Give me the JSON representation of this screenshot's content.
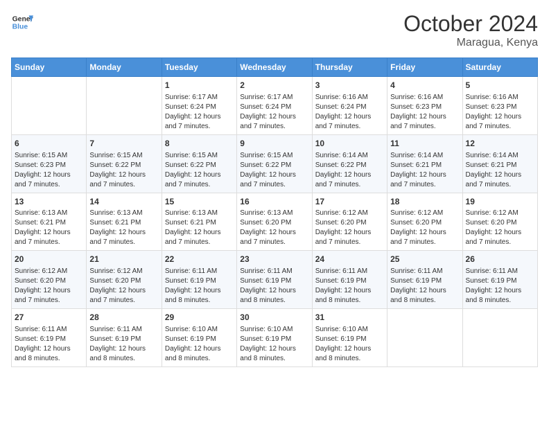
{
  "header": {
    "logo_line1": "General",
    "logo_line2": "Blue",
    "month": "October 2024",
    "location": "Maragua, Kenya"
  },
  "weekdays": [
    "Sunday",
    "Monday",
    "Tuesday",
    "Wednesday",
    "Thursday",
    "Friday",
    "Saturday"
  ],
  "weeks": [
    [
      {
        "day": "",
        "info": ""
      },
      {
        "day": "",
        "info": ""
      },
      {
        "day": "1",
        "info": "Sunrise: 6:17 AM\nSunset: 6:24 PM\nDaylight: 12 hours and 7 minutes."
      },
      {
        "day": "2",
        "info": "Sunrise: 6:17 AM\nSunset: 6:24 PM\nDaylight: 12 hours and 7 minutes."
      },
      {
        "day": "3",
        "info": "Sunrise: 6:16 AM\nSunset: 6:24 PM\nDaylight: 12 hours and 7 minutes."
      },
      {
        "day": "4",
        "info": "Sunrise: 6:16 AM\nSunset: 6:23 PM\nDaylight: 12 hours and 7 minutes."
      },
      {
        "day": "5",
        "info": "Sunrise: 6:16 AM\nSunset: 6:23 PM\nDaylight: 12 hours and 7 minutes."
      }
    ],
    [
      {
        "day": "6",
        "info": "Sunrise: 6:15 AM\nSunset: 6:23 PM\nDaylight: 12 hours and 7 minutes."
      },
      {
        "day": "7",
        "info": "Sunrise: 6:15 AM\nSunset: 6:22 PM\nDaylight: 12 hours and 7 minutes."
      },
      {
        "day": "8",
        "info": "Sunrise: 6:15 AM\nSunset: 6:22 PM\nDaylight: 12 hours and 7 minutes."
      },
      {
        "day": "9",
        "info": "Sunrise: 6:15 AM\nSunset: 6:22 PM\nDaylight: 12 hours and 7 minutes."
      },
      {
        "day": "10",
        "info": "Sunrise: 6:14 AM\nSunset: 6:22 PM\nDaylight: 12 hours and 7 minutes."
      },
      {
        "day": "11",
        "info": "Sunrise: 6:14 AM\nSunset: 6:21 PM\nDaylight: 12 hours and 7 minutes."
      },
      {
        "day": "12",
        "info": "Sunrise: 6:14 AM\nSunset: 6:21 PM\nDaylight: 12 hours and 7 minutes."
      }
    ],
    [
      {
        "day": "13",
        "info": "Sunrise: 6:13 AM\nSunset: 6:21 PM\nDaylight: 12 hours and 7 minutes."
      },
      {
        "day": "14",
        "info": "Sunrise: 6:13 AM\nSunset: 6:21 PM\nDaylight: 12 hours and 7 minutes."
      },
      {
        "day": "15",
        "info": "Sunrise: 6:13 AM\nSunset: 6:21 PM\nDaylight: 12 hours and 7 minutes."
      },
      {
        "day": "16",
        "info": "Sunrise: 6:13 AM\nSunset: 6:20 PM\nDaylight: 12 hours and 7 minutes."
      },
      {
        "day": "17",
        "info": "Sunrise: 6:12 AM\nSunset: 6:20 PM\nDaylight: 12 hours and 7 minutes."
      },
      {
        "day": "18",
        "info": "Sunrise: 6:12 AM\nSunset: 6:20 PM\nDaylight: 12 hours and 7 minutes."
      },
      {
        "day": "19",
        "info": "Sunrise: 6:12 AM\nSunset: 6:20 PM\nDaylight: 12 hours and 7 minutes."
      }
    ],
    [
      {
        "day": "20",
        "info": "Sunrise: 6:12 AM\nSunset: 6:20 PM\nDaylight: 12 hours and 7 minutes."
      },
      {
        "day": "21",
        "info": "Sunrise: 6:12 AM\nSunset: 6:20 PM\nDaylight: 12 hours and 7 minutes."
      },
      {
        "day": "22",
        "info": "Sunrise: 6:11 AM\nSunset: 6:19 PM\nDaylight: 12 hours and 8 minutes."
      },
      {
        "day": "23",
        "info": "Sunrise: 6:11 AM\nSunset: 6:19 PM\nDaylight: 12 hours and 8 minutes."
      },
      {
        "day": "24",
        "info": "Sunrise: 6:11 AM\nSunset: 6:19 PM\nDaylight: 12 hours and 8 minutes."
      },
      {
        "day": "25",
        "info": "Sunrise: 6:11 AM\nSunset: 6:19 PM\nDaylight: 12 hours and 8 minutes."
      },
      {
        "day": "26",
        "info": "Sunrise: 6:11 AM\nSunset: 6:19 PM\nDaylight: 12 hours and 8 minutes."
      }
    ],
    [
      {
        "day": "27",
        "info": "Sunrise: 6:11 AM\nSunset: 6:19 PM\nDaylight: 12 hours and 8 minutes."
      },
      {
        "day": "28",
        "info": "Sunrise: 6:11 AM\nSunset: 6:19 PM\nDaylight: 12 hours and 8 minutes."
      },
      {
        "day": "29",
        "info": "Sunrise: 6:10 AM\nSunset: 6:19 PM\nDaylight: 12 hours and 8 minutes."
      },
      {
        "day": "30",
        "info": "Sunrise: 6:10 AM\nSunset: 6:19 PM\nDaylight: 12 hours and 8 minutes."
      },
      {
        "day": "31",
        "info": "Sunrise: 6:10 AM\nSunset: 6:19 PM\nDaylight: 12 hours and 8 minutes."
      },
      {
        "day": "",
        "info": ""
      },
      {
        "day": "",
        "info": ""
      }
    ]
  ]
}
